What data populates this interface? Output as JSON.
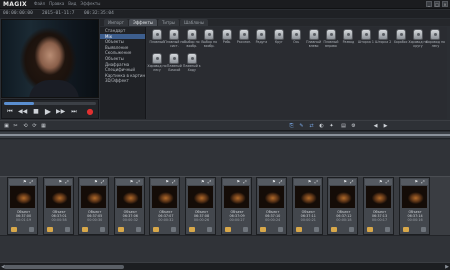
{
  "app": {
    "logo": "MAGIX",
    "menu": [
      "Файл",
      "Правка",
      "Вид",
      "Эффекты"
    ],
    "window_controls": [
      "_",
      "□",
      "×"
    ]
  },
  "timecodes": {
    "left": "00:00:00:00",
    "center": "2015-01-11:7",
    "right": "00:32:35:04"
  },
  "tabs": [
    {
      "label": "Импорт"
    },
    {
      "label": "Эффекты"
    },
    {
      "label": "Титры"
    },
    {
      "label": "Шаблоны"
    }
  ],
  "categories": [
    {
      "label": "Стандарт"
    },
    {
      "label": "Mix"
    },
    {
      "label": "Объекты"
    },
    {
      "label": "Выявление"
    },
    {
      "label": "Скольжение"
    },
    {
      "label": "Объекты"
    },
    {
      "label": "Диафрагма"
    },
    {
      "label": "Специфичный"
    },
    {
      "label": "Картинка в картин."
    },
    {
      "label": "3D/Эффект"
    }
  ],
  "effects": [
    {
      "label": "Плавный"
    },
    {
      "label": "Плавный по сист."
    },
    {
      "label": "Выбор по вхобр."
    },
    {
      "label": "Выбор по вхобр."
    },
    {
      "label": "Рябь"
    },
    {
      "label": "Рассеян."
    },
    {
      "label": "Радуга"
    },
    {
      "label": "Круг"
    },
    {
      "label": "Ось"
    },
    {
      "label": "Плавный влево"
    },
    {
      "label": "Плавный вправо"
    },
    {
      "label": "Развод"
    },
    {
      "label": "Шторка 1"
    },
    {
      "label": "Шторка 2"
    },
    {
      "label": "Хорабос"
    },
    {
      "label": "Хоровод по кругу"
    },
    {
      "label": "Хоровод по лесу"
    },
    {
      "label": "Хоровод по лесу"
    },
    {
      "label": "Плавный Бочкой"
    },
    {
      "label": "Плавный к Ходу"
    }
  ],
  "clips": [
    {
      "name": "Объект 06:37:00",
      "time": "00:01:19",
      "header": "⚑ ⤢"
    },
    {
      "name": "Объект 06:37:01",
      "time": "00:00:58",
      "header": "⚑ ⤢"
    },
    {
      "name": "Объект 06:37:05",
      "time": "00:00:30",
      "header": "⚑ ⤢"
    },
    {
      "name": "Объект 06:37:06",
      "time": "00:00:32",
      "header": "⚑ ⤢"
    },
    {
      "name": "Объект 06:37:07",
      "time": "00:00:32",
      "header": "⚑ ⤢"
    },
    {
      "name": "Объект 06:37:08",
      "time": "00:00:26",
      "header": "⚑ ⤢"
    },
    {
      "name": "Объект 06:37:09",
      "time": "00:00:27",
      "header": "⚑ ⤢"
    },
    {
      "name": "Объект 06:37:10",
      "time": "00:00:24",
      "header": "⚑ ⤢"
    },
    {
      "name": "Объект 06:37:11",
      "time": "00:00:21",
      "header": "⚑ ⤢"
    },
    {
      "name": "Объект 06:37:12",
      "time": "00:00:18",
      "header": "⚑ ⤢"
    },
    {
      "name": "Объект 06:37:13",
      "time": "00:00:17",
      "header": "⚑ ⤢"
    },
    {
      "name": "Объект 06:37:14",
      "time": "00:00:16",
      "header": "⚑ ⤢"
    }
  ],
  "transport": {
    "prev": "⏮",
    "rew": "◀◀",
    "stop": "■",
    "play": "▶",
    "fwd": "▶▶",
    "next": "⏭",
    "rec": "●"
  },
  "toolbar": {
    "icons": [
      "▣",
      "✂",
      "⟲",
      "⟳",
      "▦",
      "⎘",
      "✎",
      "⇄",
      "◐",
      "✦",
      "▤",
      "⚙",
      "◀",
      "▶"
    ]
  },
  "scroll": {
    "left": "◀",
    "right": "▶"
  },
  "colors": {
    "accent": "#3d5e8e",
    "badge": "#d8a84a",
    "record": "#e23030"
  }
}
